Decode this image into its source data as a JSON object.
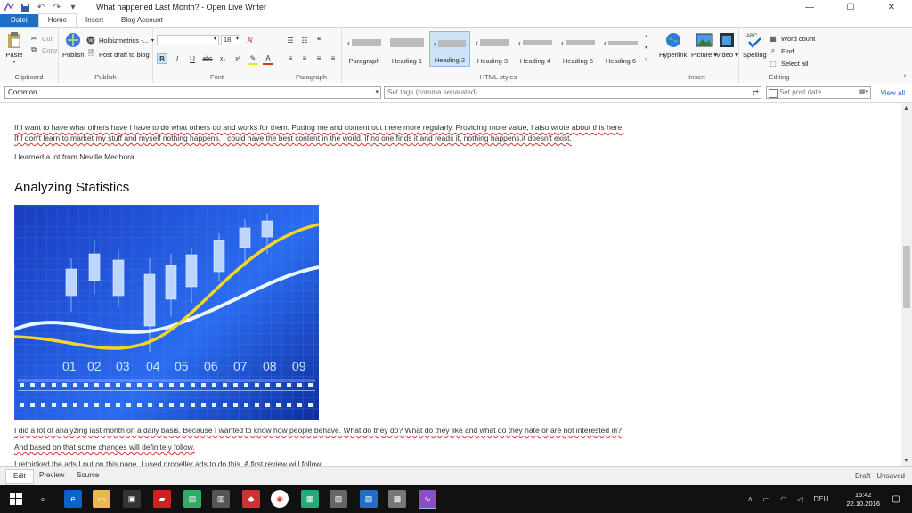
{
  "window": {
    "title": "What happened Last Month? - Open Live Writer"
  },
  "tabs": [
    "Datei",
    "Home",
    "Insert",
    "Blog Account"
  ],
  "ribbon": {
    "clipboard": {
      "label": "Clipboard",
      "paste": "Paste",
      "cut": "Cut",
      "copy": "Copy"
    },
    "publish": {
      "label": "Publish",
      "publish": "Publish",
      "blog": "Holbizmetrics -...",
      "post_draft": "Post draft to blog"
    },
    "font": {
      "label": "Font",
      "font_name": "",
      "font_size": "18"
    },
    "paragraph": {
      "label": "Paragraph"
    },
    "html_styles": {
      "label": "HTML styles",
      "items": [
        "Paragraph",
        "Heading 1",
        "Heading 2",
        "Heading 3",
        "Heading 4",
        "Heading 5",
        "Heading 6"
      ],
      "active": "Heading 2"
    },
    "insert": {
      "label": "Insert",
      "hyperlink": "Hyperlink",
      "picture": "Picture",
      "video": "Video"
    },
    "editing": {
      "label": "Editing",
      "spelling": "Spelling",
      "word_count": "Word count",
      "find": "Find",
      "select_all": "Select all"
    }
  },
  "toolbar2": {
    "category": "Common",
    "tags_placeholder": "Set tags (comma separated)",
    "post_date_placeholder": "Set post date",
    "view_all": "View all"
  },
  "editor": {
    "p1_line1": "If I want to have what others have I have to do what others do and works for them. Putting me and content out there more regularly. Providing more value, I also wrote about this here.",
    "p1_line2": "If I don't learn to market my stuff and myself nothing happens. I could have the best content in the world, if no one finds it and reads it, nothing happens.it doesn't exist.",
    "p2": "I learned a lot from Neville Medhora.",
    "heading": "Analyzing Statistics",
    "image_labels": [
      "01",
      "02",
      "03",
      "04",
      "05",
      "06",
      "07",
      "08",
      "09"
    ],
    "p3": "I did a lot of analyzing last month on a daily basis. Because I wanted to know how people behave. What do they do? What do they like and what do they hate or are not interested in?",
    "p4": "And based on that some changes will definitely follow.",
    "p5": "I rethinked the ads I put on this page. I used propeller ads to do this. A first review will follow."
  },
  "bottom": {
    "tabs": [
      "Edit",
      "Preview",
      "Source"
    ],
    "status": "Draft - Unsaved"
  },
  "taskbar": {
    "lang": "DEU",
    "time": "15:42",
    "date": "22.10.2016"
  }
}
